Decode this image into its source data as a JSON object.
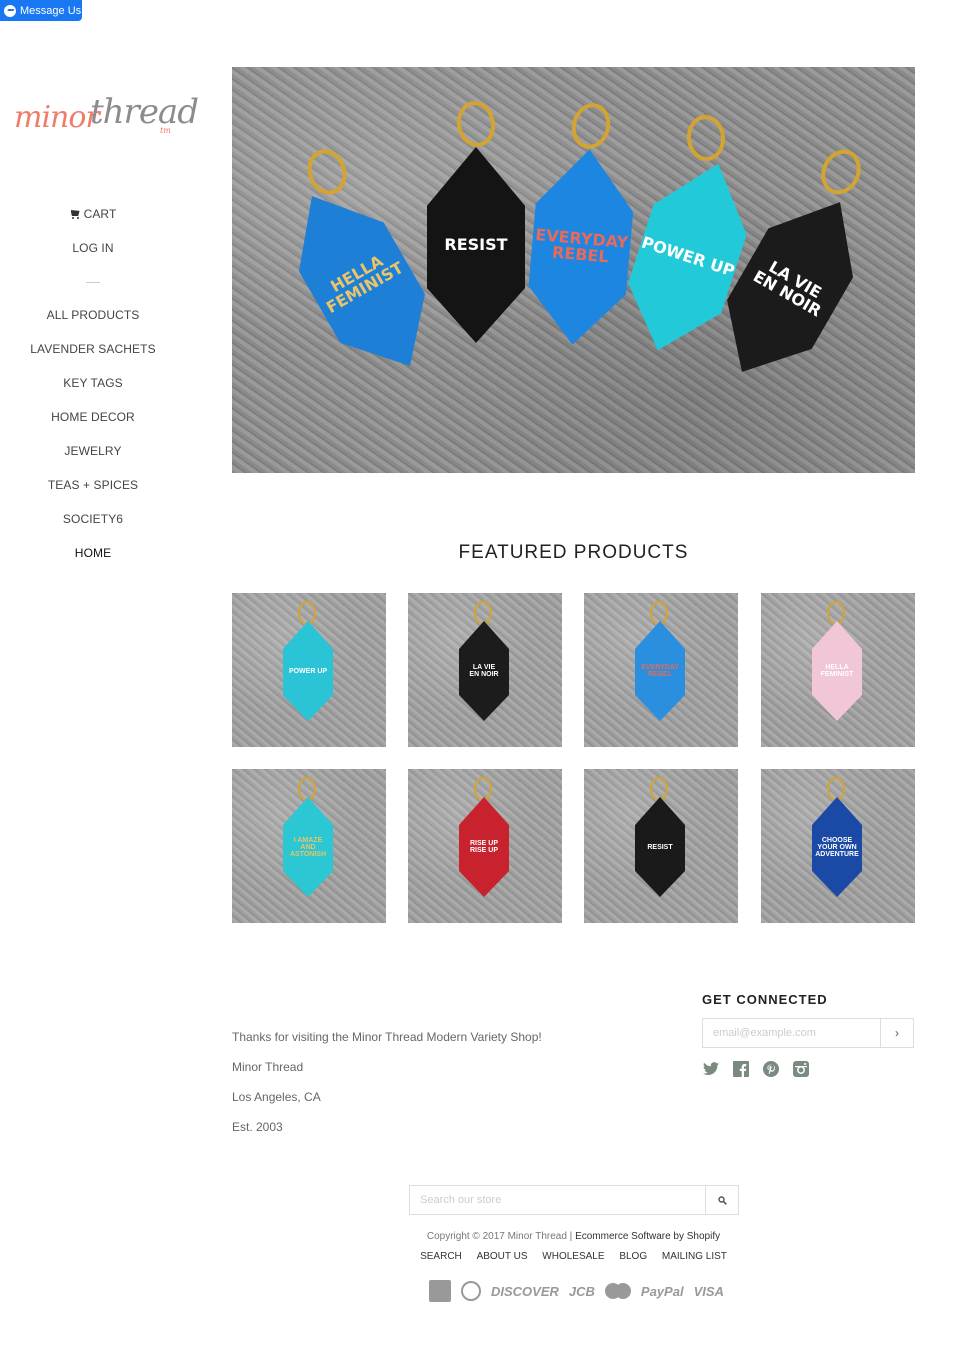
{
  "messenger": {
    "label": "Message Us"
  },
  "logo": {
    "word1": "minor",
    "word2": "thread",
    "tm": "tm"
  },
  "sidebar": {
    "account": [
      "CART",
      "LOG IN"
    ],
    "categories": [
      "ALL PRODUCTS",
      "LAVENDER SACHETS",
      "KEY TAGS",
      "HOME DECOR",
      "JEWELRY",
      "TEAS + SPICES",
      "SOCIETY6",
      "HOME"
    ]
  },
  "hero": {
    "tags": [
      {
        "text": "HELLA\nFEMINIST",
        "color": "#1e7fd6",
        "text_color": "#e9c46a"
      },
      {
        "text": "RESIST",
        "color": "#141414",
        "text_color": "#ffffff"
      },
      {
        "text": "EVERYDAY\nREBEL",
        "color": "#1c86e0",
        "text_color": "#e86a5a"
      },
      {
        "text": "POWER UP",
        "color": "#22c9d9",
        "text_color": "#ffffff"
      },
      {
        "text": "LA VIE\nEN NOIR",
        "color": "#1b1b1b",
        "text_color": "#ffffff"
      }
    ]
  },
  "featured": {
    "title": "FEATURED PRODUCTS",
    "products": [
      {
        "text": "POWER UP",
        "color": "#2bc4d6",
        "text_color": "#ffffff"
      },
      {
        "text": "LA VIE\nEN NOIR",
        "color": "#1c1c1c",
        "text_color": "#ffffff"
      },
      {
        "text": "EVERYDAY\nREBEL",
        "color": "#2b8fe0",
        "text_color": "#e36a5a"
      },
      {
        "text": "HELLA\nFEMINIST",
        "color": "#f1c6d6",
        "text_color": "#ffffff"
      },
      {
        "text": "I AMAZE\nAND\nASTONISH",
        "color": "#2bc7d2",
        "text_color": "#e9c46a"
      },
      {
        "text": "RISE UP\nRISE UP",
        "color": "#c8222e",
        "text_color": "#ffffff"
      },
      {
        "text": "RESIST",
        "color": "#1a1a1a",
        "text_color": "#ffffff"
      },
      {
        "text": "CHOOSE\nYOUR OWN\nADVENTURE",
        "color": "#1a49a6",
        "text_color": "#ffffff"
      }
    ]
  },
  "footer": {
    "about_lines": [
      "Thanks for visiting the Minor Thread Modern Variety Shop!",
      "Minor Thread",
      "Los Angeles, CA",
      "Est. 2003"
    ],
    "connected_title": "GET CONNECTED",
    "email_placeholder": "email@example.com",
    "email_submit": "›",
    "social_icons": [
      "twitter-icon",
      "facebook-icon",
      "pinterest-icon",
      "instagram-icon"
    ],
    "search_placeholder": "Search our store",
    "copyright": "Copyright © 2017 Minor Thread | ",
    "shopify": "Ecommerce Software by Shopify",
    "links": [
      "SEARCH",
      "ABOUT US",
      "WHOLESALE",
      "BLOG",
      "MAILING LIST"
    ],
    "payments": [
      "american-express-icon",
      "diners-club-icon",
      "DISCOVER",
      "JCB",
      "master-card-icon",
      "PayPal",
      "VISA"
    ]
  }
}
